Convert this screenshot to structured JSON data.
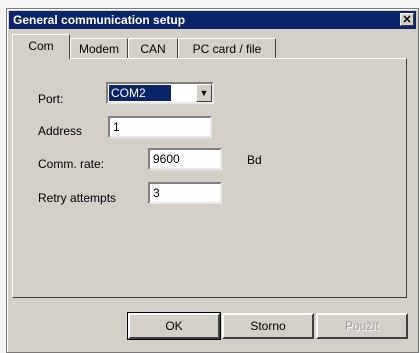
{
  "window": {
    "title": "General communication setup",
    "close_symbol": "✕"
  },
  "tabs": [
    {
      "label": "Com",
      "active": true
    },
    {
      "label": "Modem",
      "active": false
    },
    {
      "label": "CAN",
      "active": false
    },
    {
      "label": "PC card / file",
      "active": false
    }
  ],
  "form": {
    "port": {
      "label": "Port:",
      "value": "COM2",
      "dropdown_icon": "▼"
    },
    "address": {
      "label": "Address",
      "value": "1"
    },
    "comm_rate": {
      "label": "Comm. rate:",
      "value": "9600",
      "unit": "Bd"
    },
    "retry": {
      "label": "Retry attempts",
      "value": "3"
    }
  },
  "buttons": {
    "ok": "OK",
    "storno": "Storno",
    "pouzit": "Použít"
  },
  "colors": {
    "titlebar": "#0a246a",
    "face": "#d4d0c8"
  }
}
